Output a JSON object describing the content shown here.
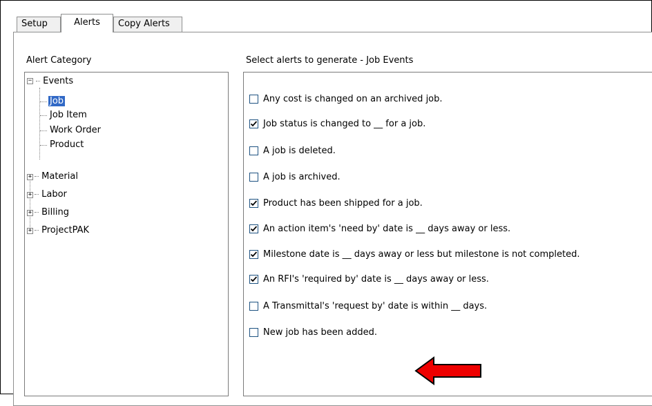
{
  "tabs": [
    "Setup",
    "Alerts",
    "Copy Alerts"
  ],
  "active_tab": "Alerts",
  "alert_category": {
    "label": "Alert Category",
    "tree": [
      {
        "label": "Events",
        "expanded": true,
        "children": [
          "Job",
          "Job Item",
          "Work Order",
          "Product"
        ]
      },
      {
        "label": "Material",
        "expanded": false
      },
      {
        "label": "Labor",
        "expanded": false
      },
      {
        "label": "Billing",
        "expanded": false
      },
      {
        "label": "ProjectPAK",
        "expanded": false
      }
    ],
    "selected": "Job"
  },
  "alerts_panel": {
    "label": "Select alerts to generate - Job Events",
    "items": [
      {
        "text": "Any cost is changed on an archived job.",
        "checked": false
      },
      {
        "text": "Job status is changed to __ for a job.",
        "checked": true
      },
      {
        "text": "A job is deleted.",
        "checked": false
      },
      {
        "text": "A job is archived.",
        "checked": false
      },
      {
        "text": "Product has been shipped for a job.",
        "checked": true
      },
      {
        "text": "An action item's 'need by' date is __ days away or less.",
        "checked": true
      },
      {
        "text": "Milestone date is __ days away or less but milestone is not completed.",
        "checked": true
      },
      {
        "text": "An RFI's 'required by' date is __ days away or less.",
        "checked": true
      },
      {
        "text": "A Transmittal's 'request by' date is within __ days.",
        "checked": false
      },
      {
        "text": "New job has been added.",
        "checked": false
      }
    ]
  },
  "annotation": {
    "icon": "red-arrow-icon",
    "color": "#ee0000",
    "points_to": "New job has been added."
  }
}
